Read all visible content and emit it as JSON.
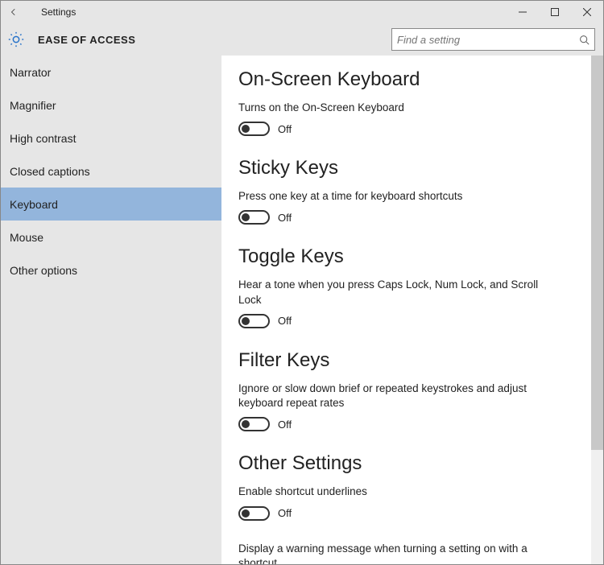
{
  "window": {
    "title": "Settings"
  },
  "header": {
    "category": "EASE OF ACCESS"
  },
  "search": {
    "placeholder": "Find a setting"
  },
  "sidebar": {
    "items": [
      {
        "label": "Narrator"
      },
      {
        "label": "Magnifier"
      },
      {
        "label": "High contrast"
      },
      {
        "label": "Closed captions"
      },
      {
        "label": "Keyboard"
      },
      {
        "label": "Mouse"
      },
      {
        "label": "Other options"
      }
    ]
  },
  "sections": {
    "osk": {
      "title": "On-Screen Keyboard",
      "desc": "Turns on the On-Screen Keyboard",
      "state": "Off"
    },
    "sticky": {
      "title": "Sticky Keys",
      "desc": "Press one key at a time for keyboard shortcuts",
      "state": "Off"
    },
    "toggle": {
      "title": "Toggle Keys",
      "desc": "Hear a tone when you press Caps Lock, Num Lock, and Scroll Lock",
      "state": "Off"
    },
    "filter": {
      "title": "Filter Keys",
      "desc": "Ignore or slow down brief or repeated keystrokes and adjust keyboard repeat rates",
      "state": "Off"
    },
    "other": {
      "title": "Other Settings",
      "desc1": "Enable shortcut underlines",
      "state1": "Off",
      "desc2": "Display a warning message when turning a setting on with a shortcut"
    }
  }
}
